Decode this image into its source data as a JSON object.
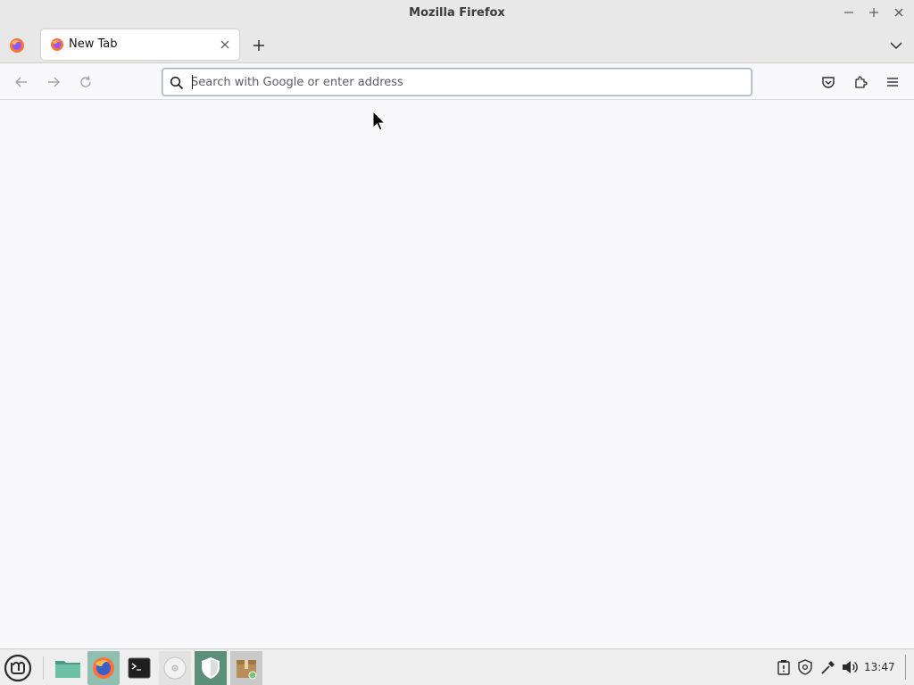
{
  "window": {
    "title": "Mozilla Firefox",
    "controls": [
      "minimize",
      "maximize",
      "close"
    ]
  },
  "tabs": [
    {
      "label": "New Tab",
      "active": true,
      "icon": "firefox-icon"
    }
  ],
  "navbar": {
    "search": {
      "placeholder": "Search with Google or enter address",
      "value": ""
    },
    "buttons": [
      "back",
      "forward",
      "reload",
      "pocket",
      "extensions",
      "menu"
    ]
  },
  "taskbar": {
    "apps": [
      "files-icon",
      "firefox-icon",
      "terminal-icon",
      "disc-icon",
      "shield-icon",
      "archive-icon"
    ],
    "tray": [
      "clipboard-icon",
      "shield-icon",
      "network-icon",
      "volume-icon"
    ],
    "clock": "13:47"
  },
  "colors": {
    "titlebar": "#e8e8e8",
    "content": "#f9f9fb",
    "taskbar": "#eeeeee",
    "accent": "#8fbfb0"
  }
}
